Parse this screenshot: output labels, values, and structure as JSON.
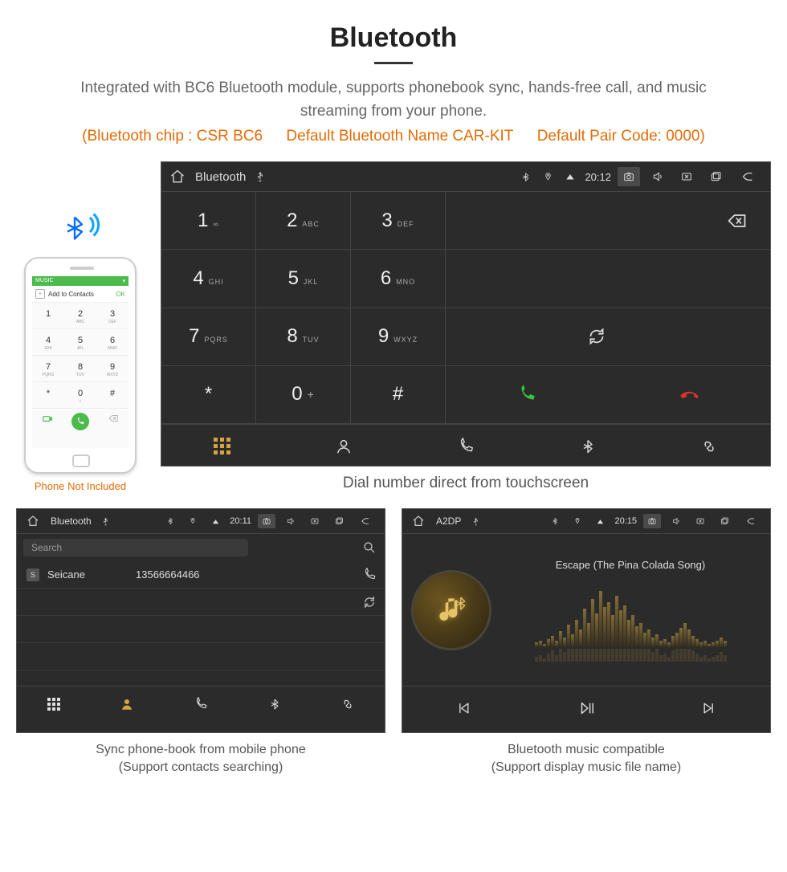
{
  "heading": "Bluetooth",
  "description": "Integrated with BC6 Bluetooth module, supports phonebook sync, hands-free call, and music streaming from your phone.",
  "chip_info": {
    "chip": "(Bluetooth chip : CSR BC6",
    "name": "Default Bluetooth Name CAR-KIT",
    "code": "Default Pair Code: 0000)"
  },
  "phone": {
    "caption": "Phone Not Included",
    "top_left": "MUSIC",
    "add_contacts": "Add to Contacts",
    "ok": "OK",
    "keys": [
      {
        "n": "1",
        "s": ""
      },
      {
        "n": "2",
        "s": "ABC"
      },
      {
        "n": "3",
        "s": "DEF"
      },
      {
        "n": "4",
        "s": "GHI"
      },
      {
        "n": "5",
        "s": "JKL"
      },
      {
        "n": "6",
        "s": "MNO"
      },
      {
        "n": "7",
        "s": "PQRS"
      },
      {
        "n": "8",
        "s": "TUV"
      },
      {
        "n": "9",
        "s": "WXYZ"
      },
      {
        "n": "*",
        "s": ""
      },
      {
        "n": "0",
        "s": "+"
      },
      {
        "n": "#",
        "s": ""
      }
    ]
  },
  "main_unit": {
    "status": {
      "title": "Bluetooth",
      "time": "20:12"
    },
    "keys": [
      {
        "n": "1",
        "s": "∞"
      },
      {
        "n": "2",
        "s": "ABC"
      },
      {
        "n": "3",
        "s": "DEF"
      },
      {
        "n": "4",
        "s": "GHI"
      },
      {
        "n": "5",
        "s": "JKL"
      },
      {
        "n": "6",
        "s": "MNO"
      },
      {
        "n": "7",
        "s": "PQRS"
      },
      {
        "n": "8",
        "s": "TUV"
      },
      {
        "n": "9",
        "s": "WXYZ"
      },
      {
        "n": "*",
        "s": ""
      },
      {
        "n": "0",
        "s": "+"
      },
      {
        "n": "#",
        "s": ""
      }
    ],
    "caption": "Dial number direct from touchscreen"
  },
  "phonebook": {
    "status": {
      "title": "Bluetooth",
      "time": "20:11"
    },
    "search_placeholder": "Search",
    "entries": [
      {
        "badge": "S",
        "name": "Seicane",
        "number": "13566664466"
      }
    ],
    "caption_line1": "Sync phone-book from mobile phone",
    "caption_line2": "(Support contacts searching)"
  },
  "music": {
    "status": {
      "title": "A2DP",
      "time": "20:15"
    },
    "song": "Escape (The Pina Colada Song)",
    "caption_line1": "Bluetooth music compatible",
    "caption_line2": "(Support display music file name)"
  }
}
